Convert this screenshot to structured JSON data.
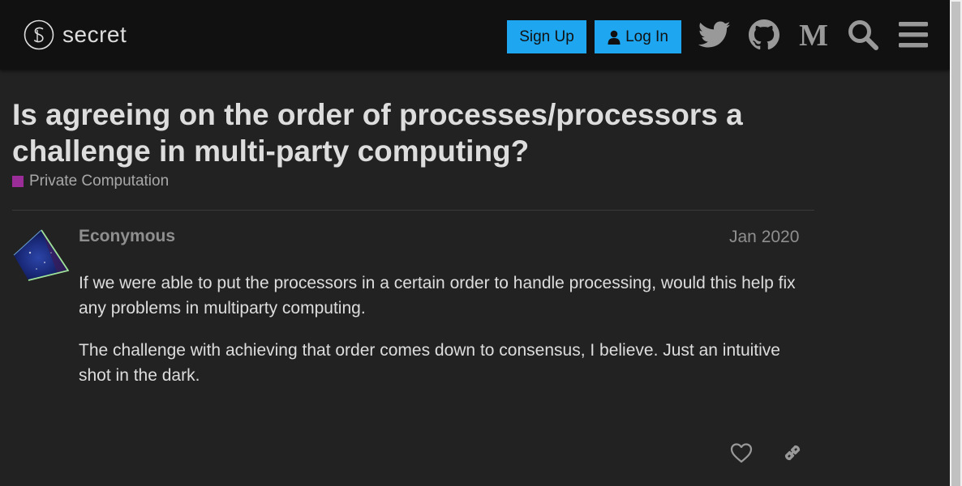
{
  "header": {
    "logo_text": "secret",
    "signup_label": "Sign Up",
    "login_label": "Log In",
    "icons": [
      "twitter-icon",
      "github-icon",
      "medium-icon",
      "search-icon",
      "hamburger-menu-icon"
    ]
  },
  "topic": {
    "title": "Is agreeing on the order of processes/processors a challenge in multi-party computing?",
    "category": "Private Computation",
    "category_color": "#9b2d98"
  },
  "post": {
    "username": "Econymous",
    "date": "Jan 2020",
    "paragraphs": [
      "If we were able to put the processors in a certain order to handle processing, would this help fix any problems in multiparty computing.",
      "The challenge with achieving that order comes down to consensus, I believe. Just an intuitive shot in the dark."
    ]
  },
  "colors": {
    "background": "#222222",
    "header": "#111111",
    "accent": "#1ea7f0",
    "text": "#dddddd",
    "muted": "#8f8f8f"
  }
}
